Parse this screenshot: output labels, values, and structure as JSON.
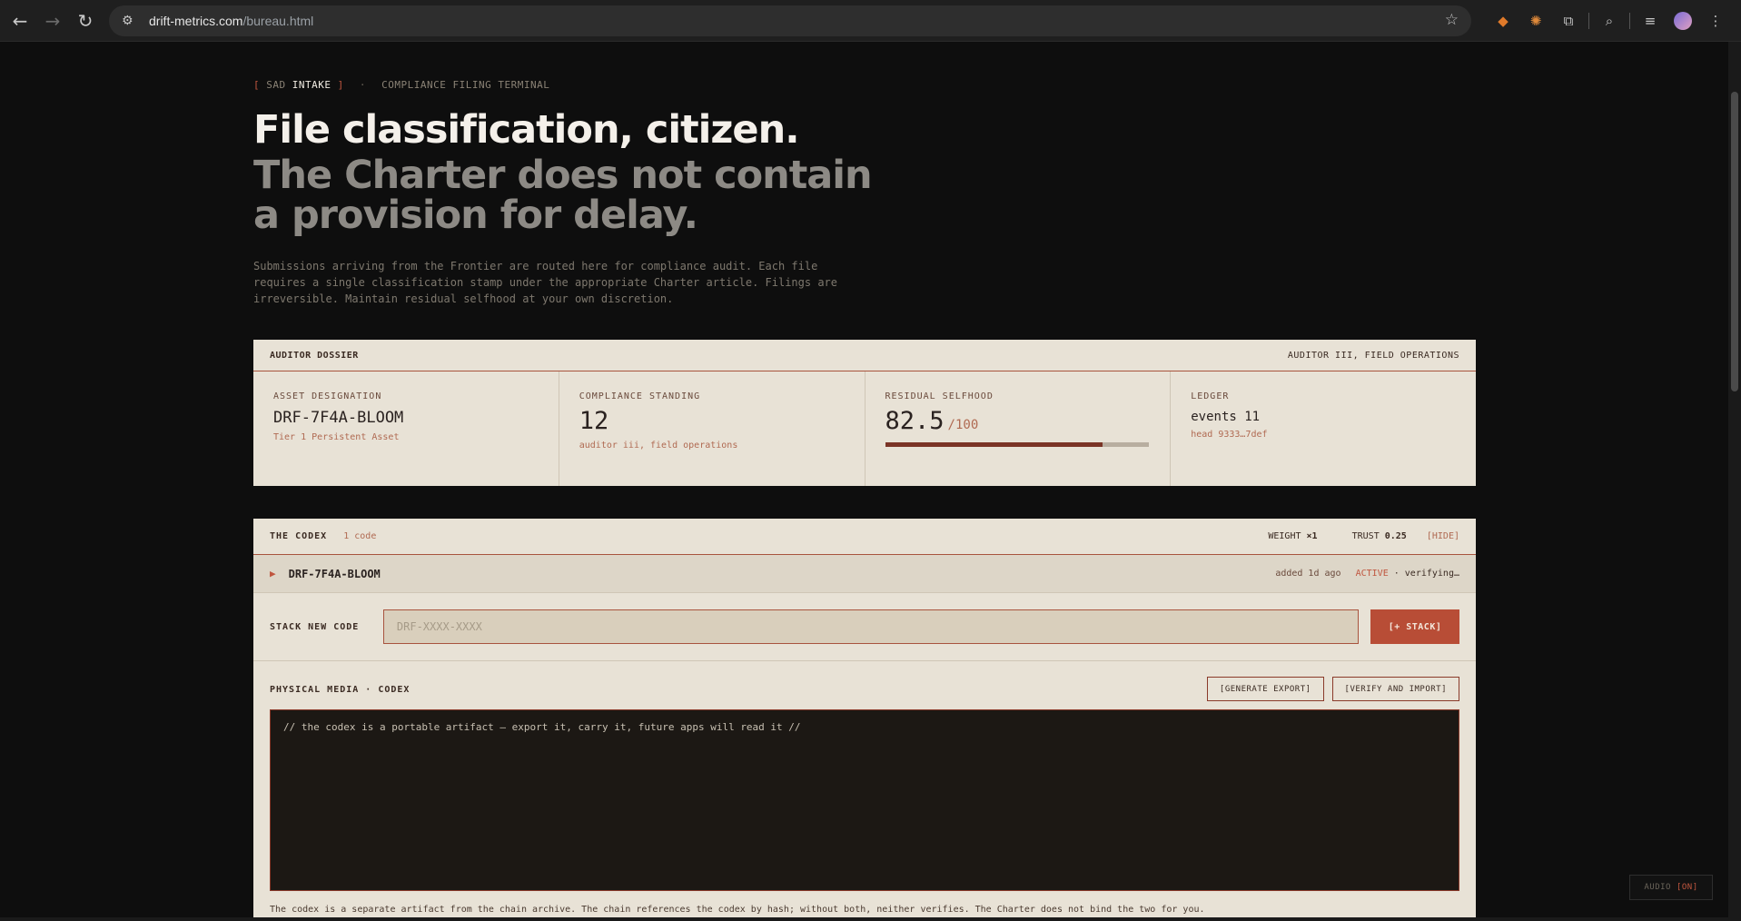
{
  "browser": {
    "url_host": "drift-metrics.com",
    "url_path": "/bureau.html"
  },
  "kicker": {
    "open": "[",
    "prefix": "SAD",
    "strong": "INTAKE",
    "close": "]",
    "dot": "·",
    "subtitle": "COMPLIANCE FILING TERMINAL"
  },
  "headline": "File classification, citizen.",
  "subheadline": "The Charter does not contain a provision for delay.",
  "lede": "Submissions arriving from the Frontier are routed here for compliance audit. Each file requires a single classification stamp under the appropriate Charter article. Filings are irreversible. Maintain residual selfhood at your own discretion.",
  "dossier": {
    "title": "AUDITOR DOSSIER",
    "role": "AUDITOR III, FIELD OPERATIONS",
    "asset": {
      "label": "ASSET DESIGNATION",
      "value": "DRF-7F4A-BLOOM",
      "sub": "Tier 1 Persistent Asset"
    },
    "standing": {
      "label": "COMPLIANCE STANDING",
      "value": "12",
      "sub": "auditor iii, field operations"
    },
    "selfhood": {
      "label": "RESIDUAL SELFHOOD",
      "value": "82.5",
      "unit": "/100",
      "fraction": 0.825
    },
    "ledger": {
      "label": "LEDGER",
      "value": "events 11",
      "sub": "head 9333…7def"
    }
  },
  "codex": {
    "title": "THE CODEX",
    "count": "1 code",
    "weight_label": "WEIGHT",
    "weight": "×1",
    "trust_label": "TRUST",
    "trust": "0.25",
    "hide": "[HIDE]",
    "entry": {
      "code": "DRF-7F4A-BLOOM",
      "added": "added 1d ago",
      "status": "ACTIVE",
      "state": "· verifying…"
    },
    "stack_label": "STACK NEW CODE",
    "stack_placeholder": "DRF-XXXX-XXXX",
    "stack_button": "[+ STACK]",
    "media_label": "PHYSICAL MEDIA · CODEX",
    "export_button": "[GENERATE EXPORT]",
    "import_button": "[VERIFY AND IMPORT]",
    "textarea_value": "// the codex is a portable artifact — export it, carry it, future apps will read it //",
    "note": "The codex is a separate artifact from the chain archive. The chain references the codex by hash; without both, neither verifies. The Charter does not bind the two for you."
  },
  "audio": {
    "label": "AUDIO",
    "state": "[ON]"
  },
  "colors": {
    "accent": "#b84d36",
    "panel": "#e8e2d6",
    "background": "#0e0e0e"
  },
  "icons": [
    "back-icon",
    "forward-icon",
    "reload-icon",
    "site-info-icon",
    "bookmark-star-icon",
    "extension-fox-icon",
    "extension-burst-icon",
    "extensions-puzzle-icon",
    "tab-search-icon",
    "media-control-icon",
    "profile-avatar-icon",
    "menu-kebab-icon"
  ]
}
